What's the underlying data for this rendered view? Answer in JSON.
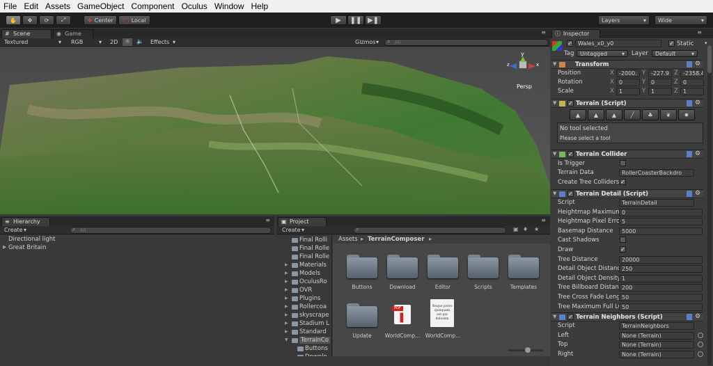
{
  "menu": [
    "File",
    "Edit",
    "Assets",
    "GameObject",
    "Component",
    "Oculus",
    "Window",
    "Help"
  ],
  "toolbar": {
    "center": "Center",
    "local": "Local",
    "layers": "Layers",
    "layout": "Wide"
  },
  "scene": {
    "tab": "Scene",
    "game_tab": "Game",
    "textured": "Textured",
    "rgb": "RGB",
    "mode2d": "2D",
    "effects": "Effects",
    "gizmos": "Gizmos",
    "search": "All",
    "persp": "Persp",
    "axis_y": "y",
    "axis_x": "x",
    "axis_z": "z"
  },
  "hierarchy": {
    "tab": "Hierarchy",
    "create": "Create",
    "search": "All",
    "items": [
      "Directional light",
      "Great Britain"
    ]
  },
  "project": {
    "tab": "Project",
    "create": "Create",
    "tree": [
      "Final Rolli",
      "Final Rolle",
      "Final Rolle",
      "Materials",
      "Models",
      "OculusRo",
      "OVR",
      "Plugins",
      "Rollercoa",
      "skyscrape",
      "Stadium L",
      "Standard",
      "TerrainCo",
      "Buttons",
      "Downlo"
    ],
    "breadcrumb": {
      "root": "Assets",
      "folder": "TerrainComposer"
    },
    "assets": [
      "Buttons",
      "Download",
      "Editor",
      "Scripts",
      "Templates",
      "Update",
      "WorldComp...",
      "WorldComp..."
    ],
    "doc_text": "Neque porro quisquam est qui dolorem"
  },
  "inspector": {
    "tab": "Inspector",
    "object_name": "Wales_x0_y0",
    "static": "Static",
    "tag_label": "Tag",
    "tag": "Untagged",
    "layer_label": "Layer",
    "layer": "Default",
    "transform": {
      "title": "Transform",
      "rows": [
        {
          "label": "Position",
          "x": "-2000.",
          "y": "-227.9",
          "z": "-2358.4"
        },
        {
          "label": "Rotation",
          "x": "0",
          "y": "0",
          "z": "0"
        },
        {
          "label": "Scale",
          "x": "1",
          "y": "1",
          "z": "1"
        }
      ]
    },
    "terrain_script": {
      "title": "Terrain (Script)",
      "msg1": "No tool selected",
      "msg2": "Please select a tool"
    },
    "collider": {
      "title": "Terrain Collider",
      "is_trigger": "Is Trigger",
      "terrain_data": "Terrain Data",
      "terrain_data_value": "RollerCoasterBackdro",
      "create_tree": "Create Tree Colliders"
    },
    "detail": {
      "title": "Terrain Detail (Script)",
      "rows": [
        {
          "label": "Script",
          "value": "TerrainDetail"
        },
        {
          "label": "Heightmap Maximum",
          "value": "0"
        },
        {
          "label": "Heightmap Pixel Error",
          "value": "5"
        },
        {
          "label": "Basemap Distance",
          "value": "5000"
        },
        {
          "label": "Cast Shadows",
          "value": ""
        },
        {
          "label": "Draw",
          "value": ""
        },
        {
          "label": "Tree Distance",
          "value": "20000"
        },
        {
          "label": "Detail Object Distance",
          "value": "250"
        },
        {
          "label": "Detail Object Density",
          "value": "1"
        },
        {
          "label": "Tree Billboard Distance",
          "value": "200"
        },
        {
          "label": "Tree Cross Fade Length",
          "value": "50"
        },
        {
          "label": "Tree Maximum Full LOD",
          "value": "50"
        }
      ]
    },
    "neighbors": {
      "title": "Terrain Neighbors (Script)",
      "rows": [
        {
          "label": "Script",
          "value": "TerrainNeighbors"
        },
        {
          "label": "Left",
          "value": "None (Terrain)"
        },
        {
          "label": "Top",
          "value": "None (Terrain)"
        },
        {
          "label": "Right",
          "value": "None (Terrain)"
        }
      ]
    }
  }
}
